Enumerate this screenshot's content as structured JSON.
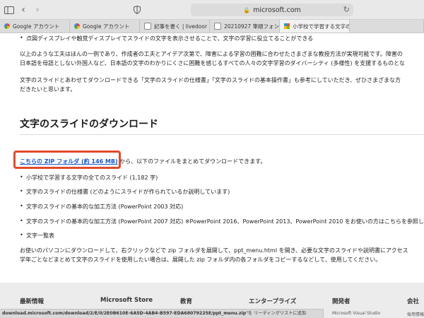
{
  "browser": {
    "address": "microsoft.com",
    "tabs": [
      {
        "title": "Google アカウント",
        "favicon": "google-icon"
      },
      {
        "title": "Google アカウント",
        "favicon": "google-icon"
      },
      {
        "title": "記事を書く | livedoor Blog",
        "favicon": "livedoor-icon"
      },
      {
        "title": "20210927 筆順フォントを使…",
        "favicon": "livedoor-icon"
      },
      {
        "title": "小学校で学習する文字の Pow...",
        "favicon": "microsoft-icon",
        "active": true
      }
    ]
  },
  "article": {
    "bullet_display": "点図ディスプレイや触覚ディスプレイでスライドの文字を表示させることで、文字の学習に役立てることができる",
    "para1_line1": "以上のような工夫はほんの一例であり、作成者の工夫とアイデア次第で、障害による学習の困難に合わせたさまざまな教授方法が実現可能です。障害の",
    "para1_line2": "日本語を母語としない外国人など、日本語の文字のわかりにくさに困難を感じるすべての人々の文字学習のダイバーシティ (多様性) を支援するものとな",
    "para2_line1": "文字のスライドとあわせてダウンロードできる「文字のスライドの仕様書」「文字のスライドの基本操作書」も参考にしていただき、ぜひさまざまな方",
    "para2_line2": "だきたいと思います。",
    "heading": "文字のスライドのダウンロード",
    "zip_link": "こちらの ZIP フォルダ (約 146 MB)",
    "zip_after": " から、以下のファイルをまとめてダウンロードできます。",
    "files": [
      "小学校で学習する文字の全てのスライド (1,182 字)",
      "文字のスライドの仕様書 (どのようにスライドが作られているか説明しています)",
      "文字のスライドの基本的な加工方法 (PowerPoint 2003 対応)",
      "文字のスライドの基本的な加工方法 (PowerPoint 2007 対応) ※PowerPoint 2016、PowerPoint 2013、PowerPoint 2010 をお使いの方はこちらを参照し",
      "文字一覧表"
    ],
    "para3_line1": "お使いのパソコンにダウンロードして、右クリックなどで zip フォルダを展開して、ppt_menu.html を開き、必要な文字のスライドや説明書にアクセス",
    "para3_line2": "学年ごとなどまとめて文字のスライドを使用したい場合は、展開した zip フォルダ内の各フォルダをコピーするなどして、使用してください。"
  },
  "footer": {
    "columns": [
      "最新情報",
      "Microsoft Store",
      "教育",
      "エンタープライズ",
      "開発者",
      "会社"
    ],
    "sub_dev": "Microsoft Visual Studio",
    "sub_company": "採用情報"
  },
  "status": {
    "url": "download.microsoft.com/download/2/E/0/2E0B610E-6A5D-4AB4-B597-EDA68079225E/ppt_menu.zip",
    "suffix": "\"を リーディングリストに追加"
  },
  "colors": {
    "link": "#1a56c4",
    "highlight_box": "#e24a2b"
  }
}
